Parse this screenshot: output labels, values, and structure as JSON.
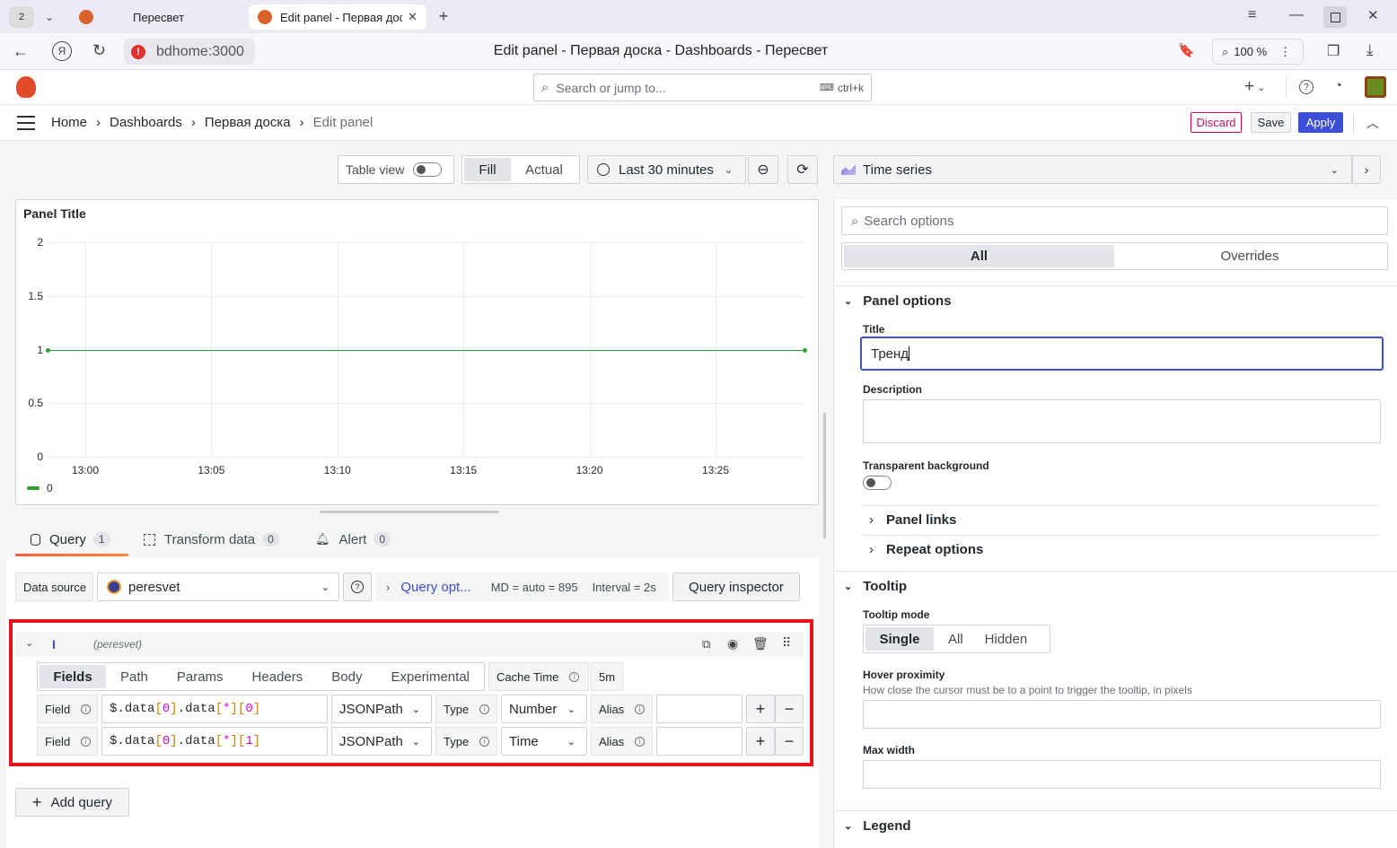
{
  "browser": {
    "tab_count": "2",
    "tabs": [
      {
        "title": "Пересвет"
      },
      {
        "title": "Edit panel - Первая доска"
      }
    ],
    "address": "bdhome:3000",
    "page_title": "Edit panel - Первая доска - Dashboards - Пересвет",
    "zoom": "100 %"
  },
  "topbar": {
    "search_placeholder": "Search or jump to...",
    "shortcut": "ctrl+k"
  },
  "breadcrumb": {
    "items": [
      "Home",
      "Dashboards",
      "Первая доска",
      "Edit panel"
    ]
  },
  "actions": {
    "discard": "Discard",
    "save": "Save",
    "apply": "Apply"
  },
  "toolbar": {
    "table_view": "Table view",
    "fill": "Fill",
    "actual": "Actual",
    "time_range": "Last 30 minutes",
    "visualization": "Time series"
  },
  "panel": {
    "title": "Panel Title"
  },
  "chart_data": {
    "type": "line",
    "title": "Panel Title",
    "x": [
      "13:00",
      "13:05",
      "13:10",
      "13:15",
      "13:20",
      "13:25"
    ],
    "series": [
      {
        "name": "0",
        "values": [
          1,
          1,
          1,
          1,
          1,
          1
        ]
      }
    ],
    "yticks": [
      "2",
      "1.5",
      "1",
      "0.5",
      "0"
    ],
    "ylim": [
      0,
      2
    ],
    "color": "#2ca02c",
    "grid": true,
    "legend": "bottom-left"
  },
  "query_tabs": [
    {
      "label": "Query",
      "count": "1"
    },
    {
      "label": "Transform data",
      "count": "0"
    },
    {
      "label": "Alert",
      "count": "0"
    }
  ],
  "datasource": {
    "label": "Data source",
    "value": "peresvet",
    "query_options": "Query opt...",
    "md": "MD = auto = 895",
    "interval": "Interval = 2s",
    "inspector": "Query inspector"
  },
  "query": {
    "refid": "I",
    "ds": "(peresvet)",
    "subtabs": [
      "Fields",
      "Path",
      "Params",
      "Headers",
      "Body",
      "Experimental"
    ],
    "cache_label": "Cache Time",
    "cache_value": "5m",
    "rows": [
      {
        "field_label": "Field",
        "expr": "$.data[0].data[*][0]",
        "lang": "JSONPath",
        "type_label": "Type",
        "type": "Number",
        "alias_label": "Alias"
      },
      {
        "field_label": "Field",
        "expr": "$.data[0].data[*][1]",
        "lang": "JSONPath",
        "type_label": "Type",
        "type": "Time",
        "alias_label": "Alias"
      }
    ],
    "add_query": "Add query"
  },
  "options": {
    "search_placeholder": "Search options",
    "tabs": [
      "All",
      "Overrides"
    ],
    "panel_options": "Panel options",
    "title_label": "Title",
    "title_value": "Тренд",
    "description_label": "Description",
    "transparent_label": "Transparent background",
    "panel_links": "Panel links",
    "repeat_options": "Repeat options",
    "tooltip": "Tooltip",
    "tooltip_mode_label": "Tooltip mode",
    "tooltip_modes": [
      "Single",
      "All",
      "Hidden"
    ],
    "hover_label": "Hover proximity",
    "hover_desc": "How close the cursor must be to a point to trigger the tooltip, in pixels",
    "max_width_label": "Max width",
    "legend": "Legend"
  }
}
